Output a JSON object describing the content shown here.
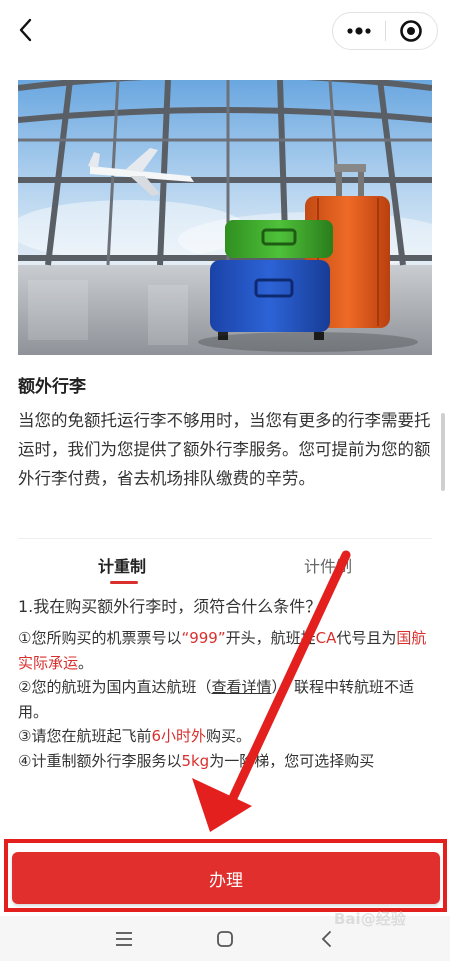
{
  "header": {
    "back_icon": "chevron-left-icon",
    "more_icon": "more-dots-icon",
    "close_icon": "target-circle-icon"
  },
  "hero": {
    "image": "airport-luggage-photo"
  },
  "content": {
    "title": "额外行李",
    "intro": "当您的免额托运行李不够用时，当您有更多的行李需要托运时，我们为您提供了额外行李服务。您可提前为您的额外行李付费，省去机场排队缴费的辛劳。"
  },
  "tabs": [
    {
      "label": "计重制",
      "active": true
    },
    {
      "label": "计件制",
      "active": false
    }
  ],
  "rules": {
    "question": "1.我在购买额外行李时，须符合什么条件？",
    "items": [
      {
        "a": "①您所购买的机票票号以",
        "b": "“999”",
        "c": "开头，航班挂",
        "d": "CA",
        "e": "代号且为",
        "f": "国航实际承运",
        "g": "。"
      },
      {
        "a": "②您的航班为国内直达航班（",
        "link": "查看详情",
        "b": "）。联程中转航班不适用。"
      },
      {
        "a": "③请您在航班起飞前",
        "b": "6小时外",
        "c": "购买。"
      },
      {
        "a": "④计重制额外行李服务以",
        "b": "5kg",
        "c": "为一阶梯，您可选择购买"
      }
    ]
  },
  "action": {
    "label": "办理"
  },
  "navbar": {
    "menu_icon": "menu-lines-icon",
    "home_icon": "home-square-icon",
    "back_icon": "nav-back-icon"
  },
  "colors": {
    "accent": "#e02f2d",
    "annotation": "#e3201e"
  },
  "watermark": {
    "text": "Bai@经验"
  }
}
